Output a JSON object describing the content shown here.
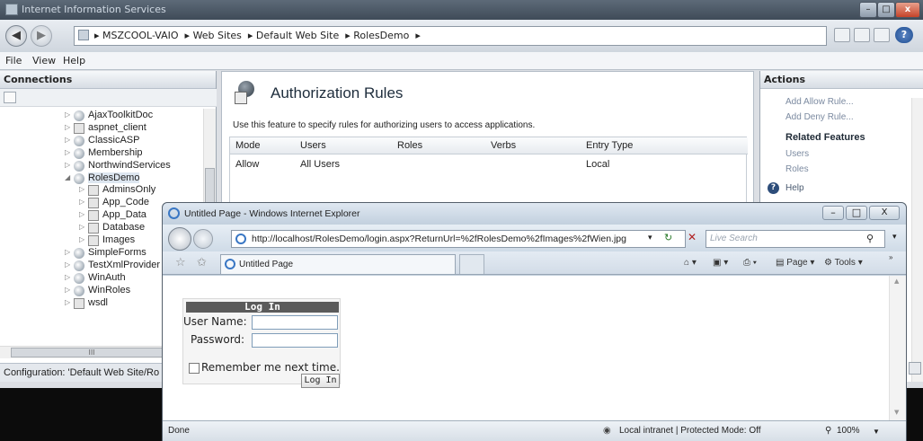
{
  "iis": {
    "window_title": "Internet Information Services",
    "breadcrumb": [
      "MSZCOOL-VAIO",
      "Web Sites",
      "Default Web Site",
      "RolesDemo"
    ],
    "menu": [
      "File",
      "View",
      "Help"
    ],
    "connections": {
      "title": "Connections",
      "tree": [
        {
          "label": "AjaxToolkitDoc",
          "icon": "site-icon",
          "level": 0
        },
        {
          "label": "aspnet_client",
          "icon": "folder-icon",
          "level": 0
        },
        {
          "label": "ClassicASP",
          "icon": "site-icon",
          "level": 0
        },
        {
          "label": "Membership",
          "icon": "site-icon",
          "level": 0
        },
        {
          "label": "NorthwindServices",
          "icon": "site-icon",
          "level": 0
        },
        {
          "label": "RolesDemo",
          "icon": "site-icon",
          "level": 0,
          "expanded": true,
          "selected": true
        },
        {
          "label": "AdminsOnly",
          "icon": "folder-icon",
          "level": 1
        },
        {
          "label": "App_Code",
          "icon": "folder-icon",
          "level": 1
        },
        {
          "label": "App_Data",
          "icon": "folder-icon",
          "level": 1
        },
        {
          "label": "Database",
          "icon": "folder-icon",
          "level": 1
        },
        {
          "label": "Images",
          "icon": "folder-icon",
          "level": 1
        },
        {
          "label": "SimpleForms",
          "icon": "site-icon",
          "level": 0
        },
        {
          "label": "TestXmlProvider",
          "icon": "site-icon",
          "level": 0
        },
        {
          "label": "WinAuth",
          "icon": "site-icon",
          "level": 0
        },
        {
          "label": "WinRoles",
          "icon": "site-icon",
          "level": 0
        },
        {
          "label": "wsdl",
          "icon": "folder-icon",
          "level": 0
        }
      ],
      "hscroll_glyph": "III"
    },
    "status": "Configuration: 'Default Web Site/Ro",
    "feature": {
      "title": "Authorization Rules",
      "description": "Use this feature to specify rules for authorizing users to access applications.",
      "columns": [
        "Mode",
        "Users",
        "Roles",
        "Verbs",
        "Entry Type"
      ],
      "rows": [
        {
          "mode": "Allow",
          "users": "All Users",
          "roles": "",
          "verbs": "",
          "entry_type": "Local"
        }
      ]
    },
    "actions": {
      "title": "Actions",
      "items": [
        "Add Allow Rule...",
        "Add Deny Rule..."
      ],
      "related_title": "Related Features",
      "related": [
        "Users",
        "Roles"
      ],
      "help": "Help"
    }
  },
  "ie": {
    "window_title": "Untitled Page - Windows Internet Explorer",
    "url": "http://localhost/RolesDemo/login.aspx?ReturnUrl=%2fRolesDemo%2fImages%2fWien.jpg",
    "search_placeholder": "Live Search",
    "tab_title": "Untitled Page",
    "commands": {
      "page": "Page",
      "tools": "Tools"
    },
    "status_left": "Done",
    "zone": "Local intranet | Protected Mode: Off",
    "zoom": "100%",
    "login": {
      "header": "Log In",
      "username_label": "User Name:",
      "password_label": "Password:",
      "remember_label": "Remember me next time.",
      "button": "Log In",
      "username_value": "",
      "password_value": ""
    }
  },
  "colors": {
    "accent": "#3f4b58",
    "selection": "#dde6f0",
    "login_header": "#5b5b5b"
  }
}
